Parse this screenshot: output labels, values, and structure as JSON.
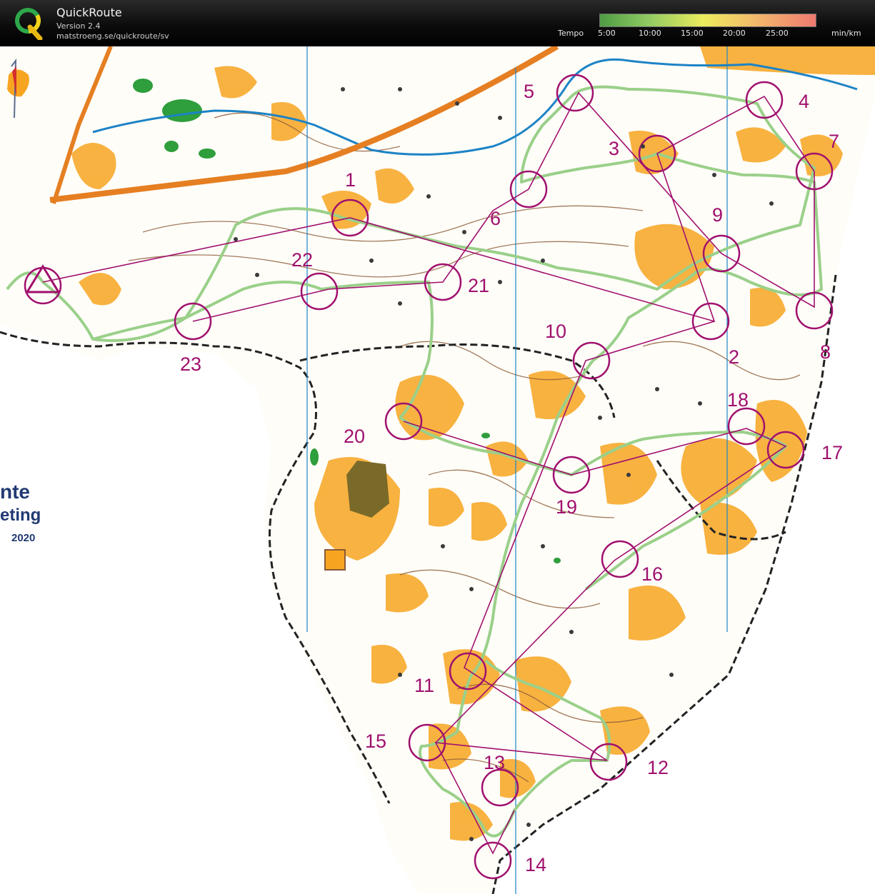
{
  "app": {
    "title": "QuickRoute",
    "version": "Version 2.4",
    "url": "matstroeng.se/quickroute/sv"
  },
  "tempo": {
    "label": "Tempo",
    "ticks": [
      "5:00",
      "10:00",
      "15:00",
      "20:00",
      "25:00"
    ],
    "unit": "min/km"
  },
  "map": {
    "sponsor_logo_lines": [
      "nte",
      "eting",
      "2020"
    ],
    "controls": [
      "1",
      "2",
      "3",
      "4",
      "5",
      "6",
      "7",
      "8",
      "9",
      "10",
      "11",
      "12",
      "13",
      "14",
      "15",
      "16",
      "17",
      "18",
      "19",
      "20",
      "21",
      "22",
      "23"
    ]
  },
  "colors": {
    "course": "#a0106e",
    "route": "#9ad08a",
    "vegetation": "#f7a521",
    "forest_green": "#2f9e3c",
    "water": "#1c83c6",
    "road": "#e57f22",
    "contour": "#8b5a36"
  }
}
